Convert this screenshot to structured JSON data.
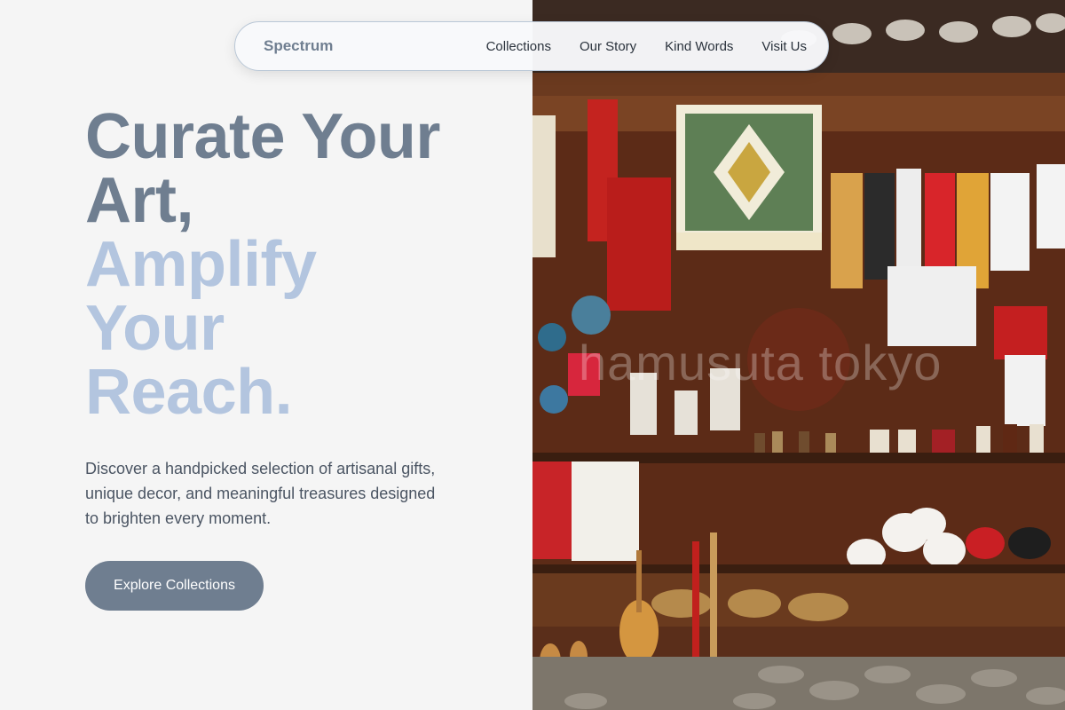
{
  "nav": {
    "brand": "Spectrum",
    "links": [
      "Collections",
      "Our Story",
      "Kind Words",
      "Visit Us"
    ]
  },
  "hero": {
    "headline_lines": [
      "Curate Your",
      "Art,",
      "Amplify",
      "Your",
      "Reach."
    ],
    "description": "Discover a handpicked selection of artisanal gifts, unique decor, and meaningful treasures designed to brighten every moment.",
    "cta_label": "Explore Collections"
  },
  "photo": {
    "watermark": "hamusuta tokyo"
  },
  "colors": {
    "background": "#f5f5f5",
    "slate": "#6f7e90",
    "accent_light": "#b3c5df",
    "body_text": "#4b5563"
  }
}
